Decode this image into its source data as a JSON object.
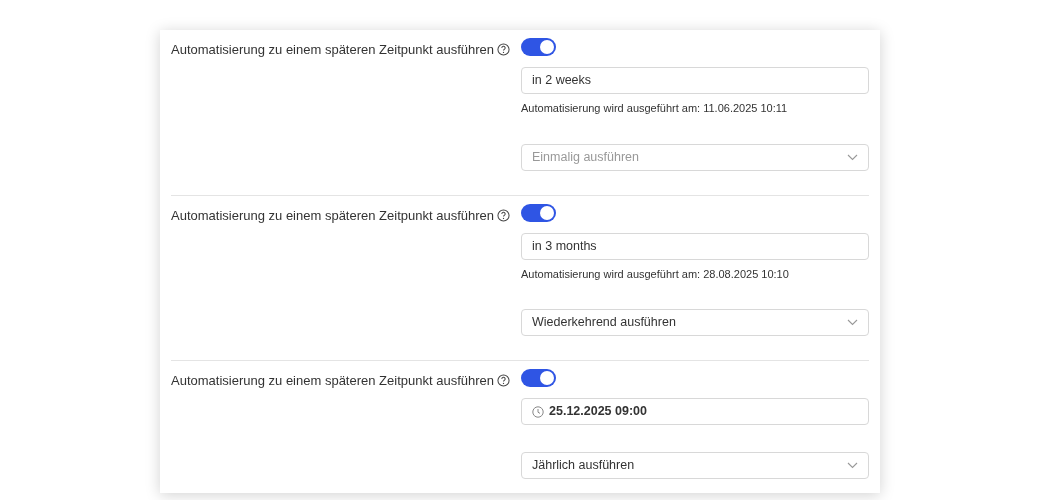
{
  "sections": [
    {
      "label": "Automatisierung zu einem späteren Zeitpunkt ausführen",
      "toggle_on": true,
      "input": {
        "kind": "text",
        "value": "in 2 weeks"
      },
      "note": "Automatisierung wird ausgeführt am: 11.06.2025 10:11",
      "select": {
        "placeholder": "Einmalig ausführen"
      }
    },
    {
      "label": "Automatisierung zu einem späteren Zeitpunkt ausführen",
      "toggle_on": true,
      "input": {
        "kind": "text",
        "value": "in 3 months"
      },
      "note": "Automatisierung wird ausgeführt am: 28.08.2025 10:10",
      "select": {
        "value": "Wiederkehrend ausführen"
      }
    },
    {
      "label": "Automatisierung zu einem späteren Zeitpunkt ausführen",
      "toggle_on": true,
      "input": {
        "kind": "datetime",
        "value": "25.12.2025 09:00"
      },
      "select": {
        "value": "Jährlich ausführen"
      }
    }
  ]
}
